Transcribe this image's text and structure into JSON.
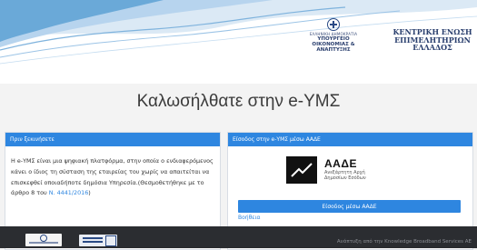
{
  "header": {
    "ministry_line1": "ΕΛΛΗΝΙΚΗ ΔΗΜΟΚΡΑΤΙΑ",
    "ministry_line2": "ΥΠΟΥΡΓΕΙΟ",
    "ministry_line3": "ΟΙΚΟΝΟΜΙΑΣ & ΑΝΑΠΤΥΞΗΣ",
    "chamber_line1": "ΚΕΝΤΡΙΚΗ ΕΝΩΣΗ",
    "chamber_line2": "ΕΠΙΜΕΛΗΤΗΡΙΩΝ",
    "chamber_line3": "ΕΛΛΑΔΟΣ",
    "accent_color": "#2e86e0",
    "wave_color": "#6aa9d8"
  },
  "welcome_title": "Καλωσήλθατε στην e-ΥΜΣ",
  "intro_card": {
    "heading": "Πριν ξεκινήσετε",
    "paragraph": "Η e-ΥΜΣ είναι μια ψηφιακή πλατφόρμα, στην οποία ο ενδιαφερόμενος κάνει ο ίδιος τη σύσταση της εταιρείας του χωρίς να απαιτείται να επισκεφθεί οποιαδήποτε δημόσια Υπηρεσία.(Θεσμοθετήθηκε με το άρθρο 8 του ",
    "law_link": "Ν. 4441/2016",
    "paragraph_end": ")"
  },
  "login_card": {
    "heading": "Είσοδος στην e-ΥΜΣ μέσω ΑΑΔΕ",
    "logo_name": "ΑΑΔΕ",
    "logo_line1": "Ανεξάρτητη Αρχή",
    "logo_line2": "Δημοσίων Εσόδων",
    "button_label": "Είσοδος μέσω ΑΑΔΕ",
    "help_label": "Βοήθεια"
  },
  "footer": {
    "text": "Ανάπτυξη από την Knowledge Broadband Services AE",
    "background": "#2b2d31"
  }
}
